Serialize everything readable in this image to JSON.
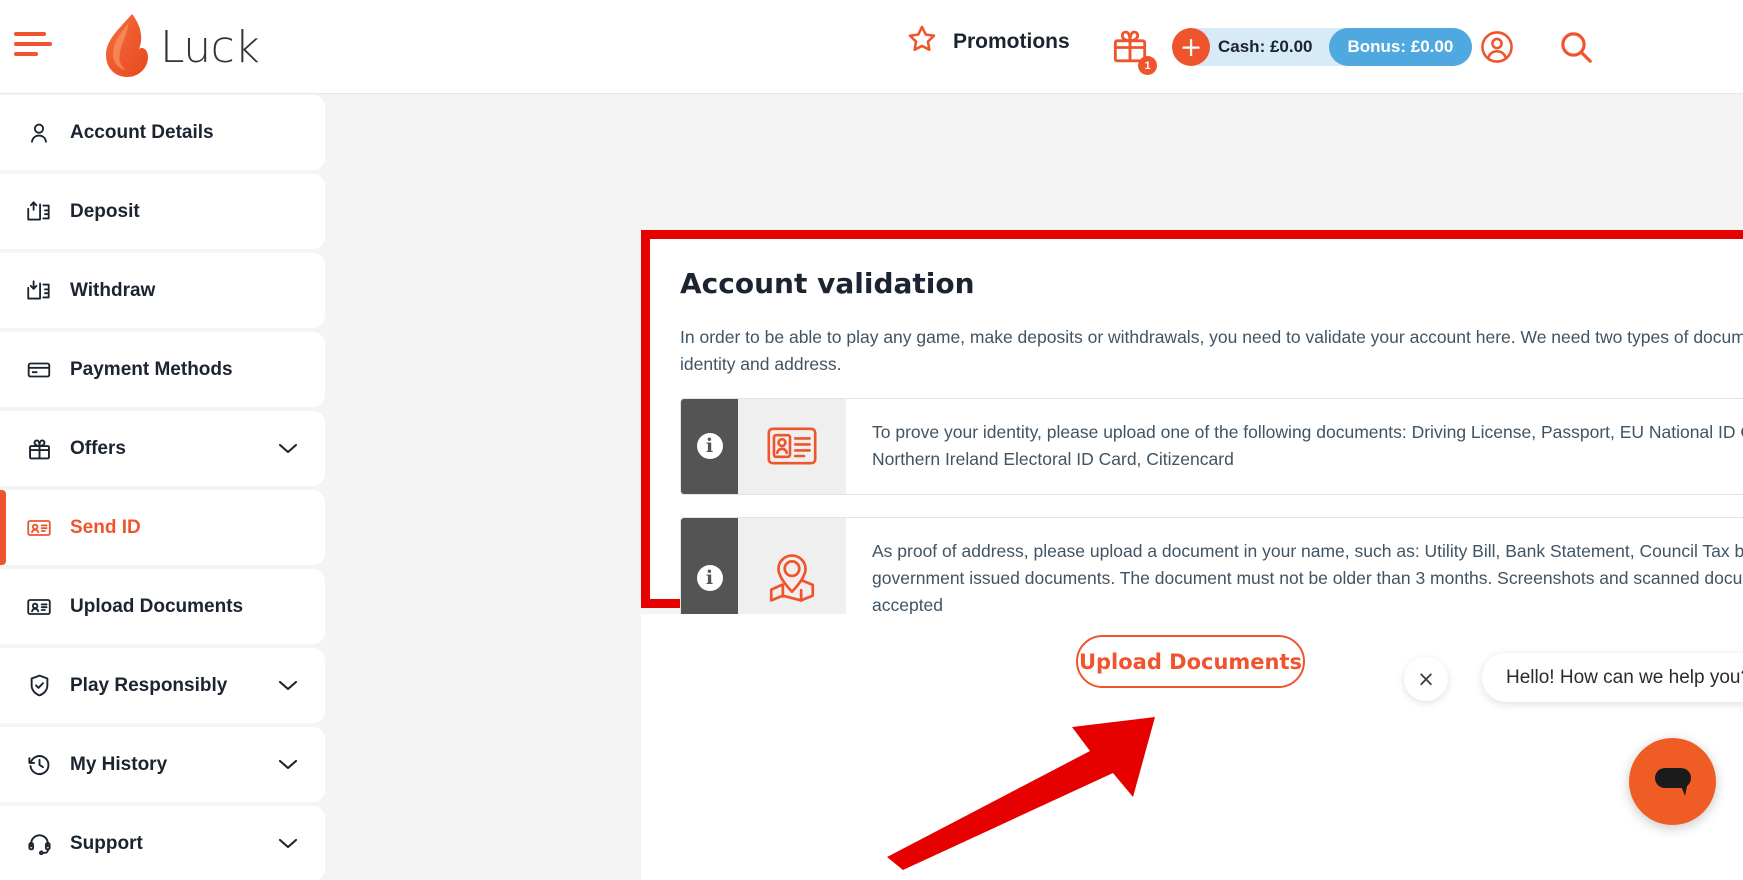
{
  "header": {
    "menu_icon": "hamburger-icon",
    "logo_text": "Luck",
    "logo_icon": "flame-icon",
    "promotions_label": "Promotions",
    "promotions_icon": "star-icon",
    "gift_icon": "gift-icon",
    "gift_badge_count": "1",
    "plus_label": "+",
    "cash_label": "Cash: £0.00",
    "bonus_label": "Bonus: £0.00",
    "account_icon": "user-circle-icon",
    "search_icon": "search-icon"
  },
  "sidebar": {
    "items": [
      {
        "label": "Account Details",
        "icon": "user-icon",
        "chevron": false,
        "active": false
      },
      {
        "label": "Deposit",
        "icon": "deposit-icon",
        "chevron": false,
        "active": false
      },
      {
        "label": "Withdraw",
        "icon": "withdraw-icon",
        "chevron": false,
        "active": false
      },
      {
        "label": "Payment Methods",
        "icon": "credit-card-icon",
        "chevron": false,
        "active": false
      },
      {
        "label": "Offers",
        "icon": "gift-icon",
        "chevron": true,
        "active": false
      },
      {
        "label": "Send ID",
        "icon": "id-card-icon",
        "chevron": false,
        "active": true
      },
      {
        "label": "Upload Documents",
        "icon": "id-card-icon",
        "chevron": false,
        "active": false
      },
      {
        "label": "Play Responsibly",
        "icon": "shield-check-icon",
        "chevron": true,
        "active": false
      },
      {
        "label": "My History",
        "icon": "history-clock-icon",
        "chevron": true,
        "active": false
      },
      {
        "label": "Support",
        "icon": "headset-icon",
        "chevron": true,
        "active": false
      }
    ]
  },
  "main": {
    "title": "Account validation",
    "description": "In order to be able to play any game, make deposits or withdrawals, you need to validate your account here. We need two types of documents: proof of identity and address.",
    "info_rows": [
      {
        "info_icon": "info-icon",
        "picture_icon": "id-card-icon",
        "text": "To prove your identity, please upload one of the following documents: Driving License, Passport, EU National ID Card, Northern Ireland Electoral ID Card, Citizencard"
      },
      {
        "info_icon": "info-icon",
        "picture_icon": "map-pin-icon",
        "text": "As proof of address, please upload a document in your name, such as: Utility Bill, Bank Statement, Council Tax bill or other government issued documents. The document must not be older than 3 months. Screenshots and scanned documents are not accepted"
      }
    ],
    "upload_button_label": "Upload Documents"
  },
  "annotations": {
    "highlight_color": "#e60000",
    "arrow_color": "#e60000",
    "highlight_name": "red-highlight-rectangle",
    "arrow_name": "red-pointer-arrow"
  },
  "chat": {
    "close_label": "×",
    "greeting": "Hello! How can we help you?",
    "fab_icon": "chat-bubble-icon"
  },
  "colors": {
    "brand_orange": "#f0542c",
    "bonus_blue": "#4fa8e0",
    "cash_blue": "#d6eaf8",
    "text_dark": "#1b2430"
  }
}
